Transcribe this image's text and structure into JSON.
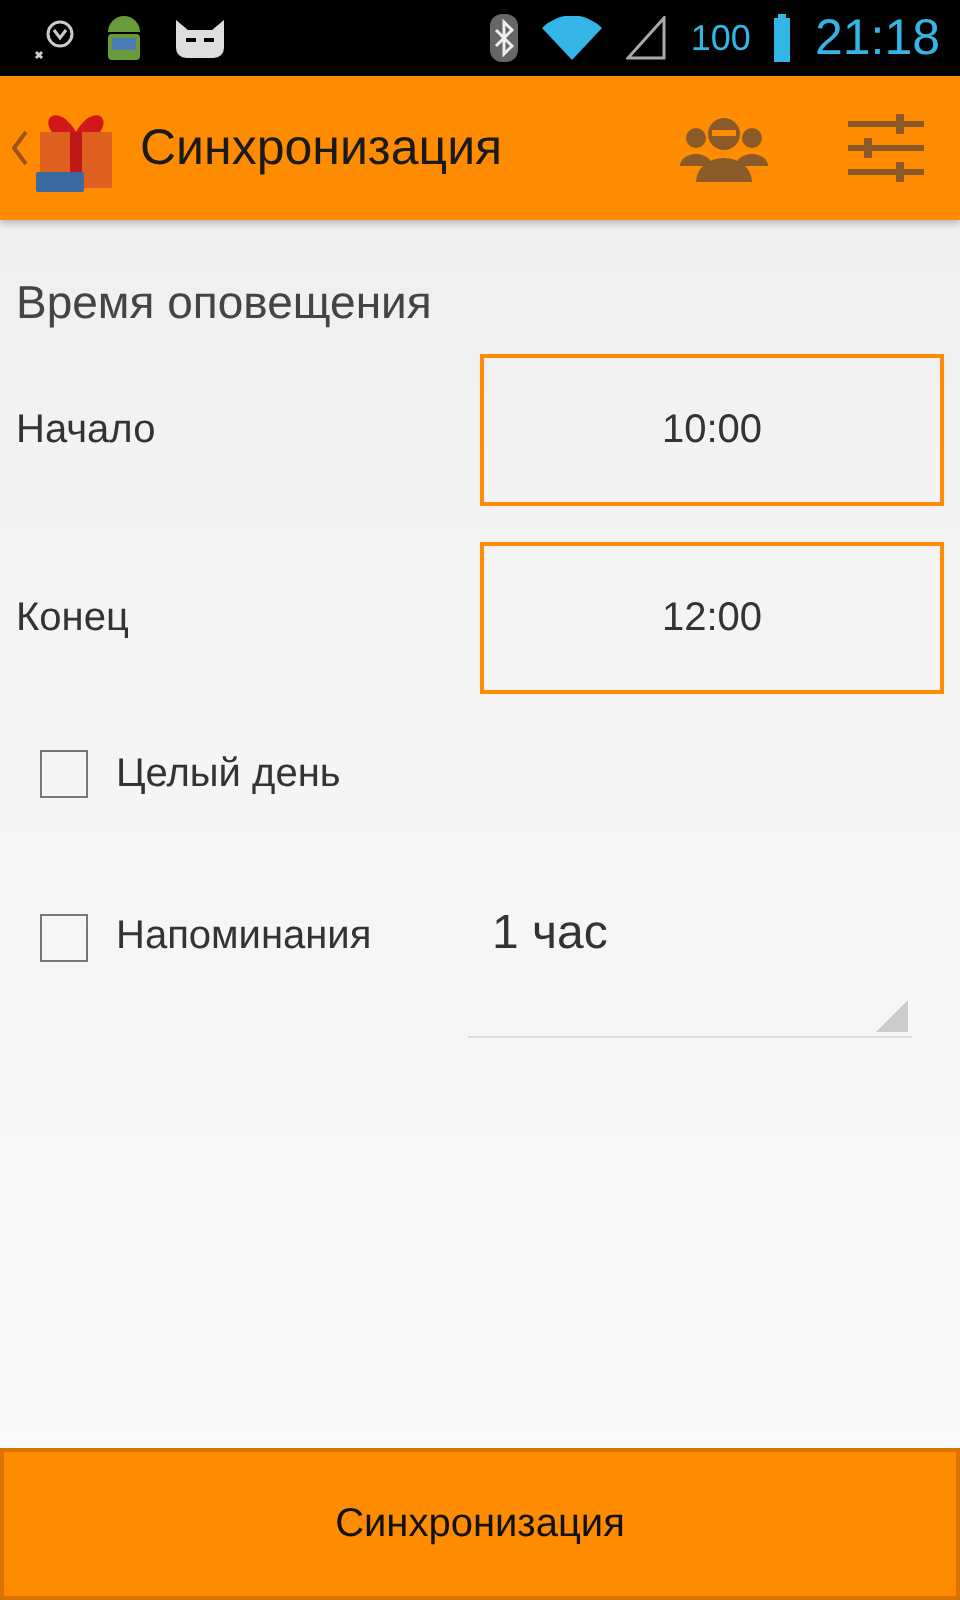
{
  "status_bar": {
    "battery_percent": "100",
    "time": "21:18"
  },
  "app_bar": {
    "title": "Синхронизация"
  },
  "section_title": "Время оповещения",
  "time_fields": [
    {
      "label": "Начало",
      "value": "10:00"
    },
    {
      "label": "Конец",
      "value": "12:00"
    }
  ],
  "options": [
    {
      "label": "Целый день",
      "checked": false
    },
    {
      "label": "Напоминания",
      "checked": false,
      "spinner_value": "1 час"
    }
  ],
  "sync_button": "Синхронизация"
}
